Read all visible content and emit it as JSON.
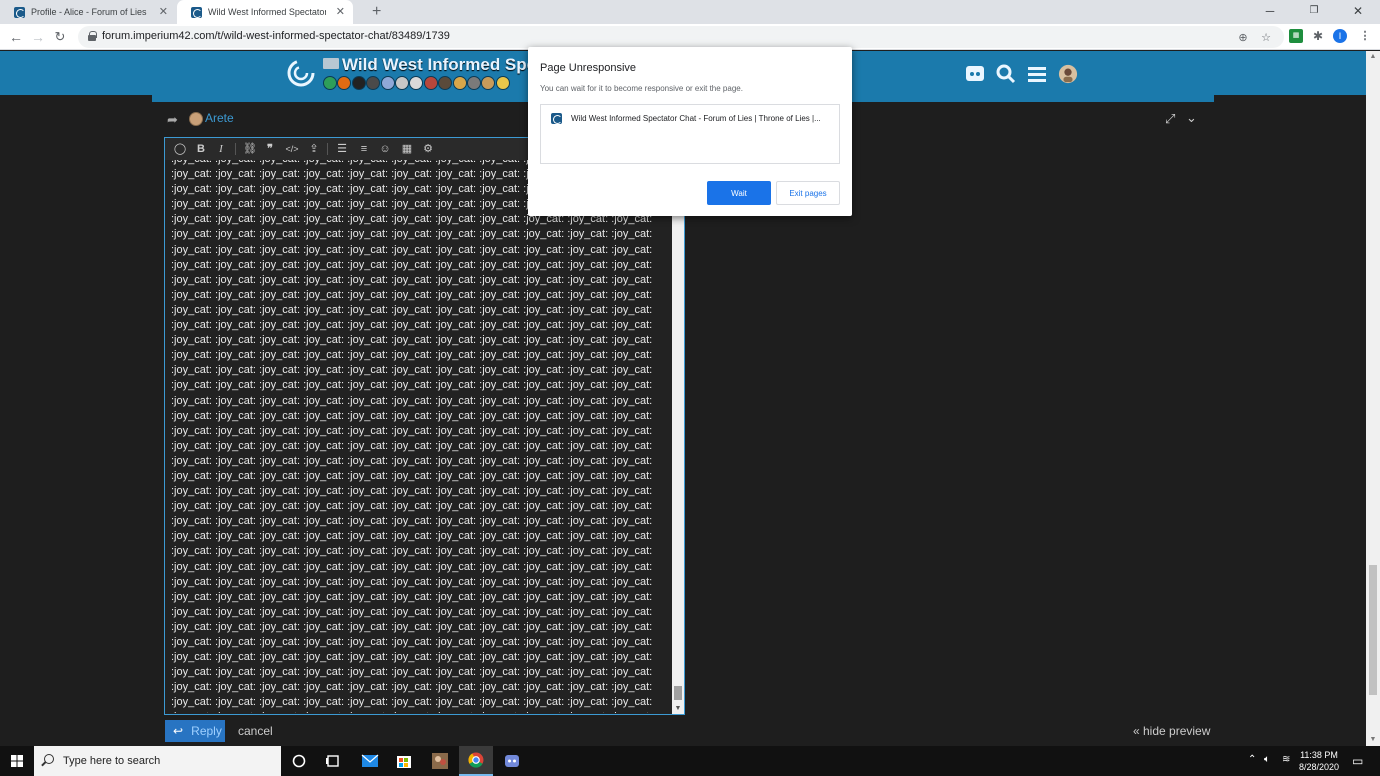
{
  "browser": {
    "tabs": [
      {
        "title": "Profile - Alice - Forum of Lies | Th"
      },
      {
        "title": "Wild West Informed Spectator Ch"
      }
    ],
    "url": "forum.imperium42.com/t/wild-west-informed-spectator-chat/83489/1739",
    "profile_initial": "I"
  },
  "forum": {
    "title": "Wild West Informed Spe",
    "flair_colors": [
      "#2e9e5a",
      "#e26b12",
      "#222222",
      "#4a4a4a",
      "#8fa8d8",
      "#c7c7c7",
      "#d9d9d9",
      "#b8473c",
      "#5a4a3a",
      "#d8a64a",
      "#7a7a7a",
      "#c89b5a",
      "#e8c64a"
    ]
  },
  "reply": {
    "reply_to_name": "Arete",
    "body_line": ":joy_cat: :joy_cat: :joy_cat: :joy_cat: :joy_cat: :joy_cat: :joy_cat: :joy_cat: :joy_cat: :joy_cat: :joy_cat:",
    "reply_label": "Reply",
    "cancel_label": "cancel",
    "hide_preview_label": "« hide preview"
  },
  "dialog": {
    "title": "Page Unresponsive",
    "message": "You can wait for it to become responsive or exit the page.",
    "page_title": "Wild West Informed Spectator Chat - Forum of Lies | Throne of Lies |...",
    "wait_label": "Wait",
    "exit_label": "Exit pages"
  },
  "taskbar": {
    "search_placeholder": "Type here to search",
    "time": "11:38 PM",
    "date": "8/28/2020"
  },
  "colors": {
    "forum_accent": "#1b7aac",
    "link_blue": "#3c9ad3",
    "button_blue": "#1a73e8"
  }
}
